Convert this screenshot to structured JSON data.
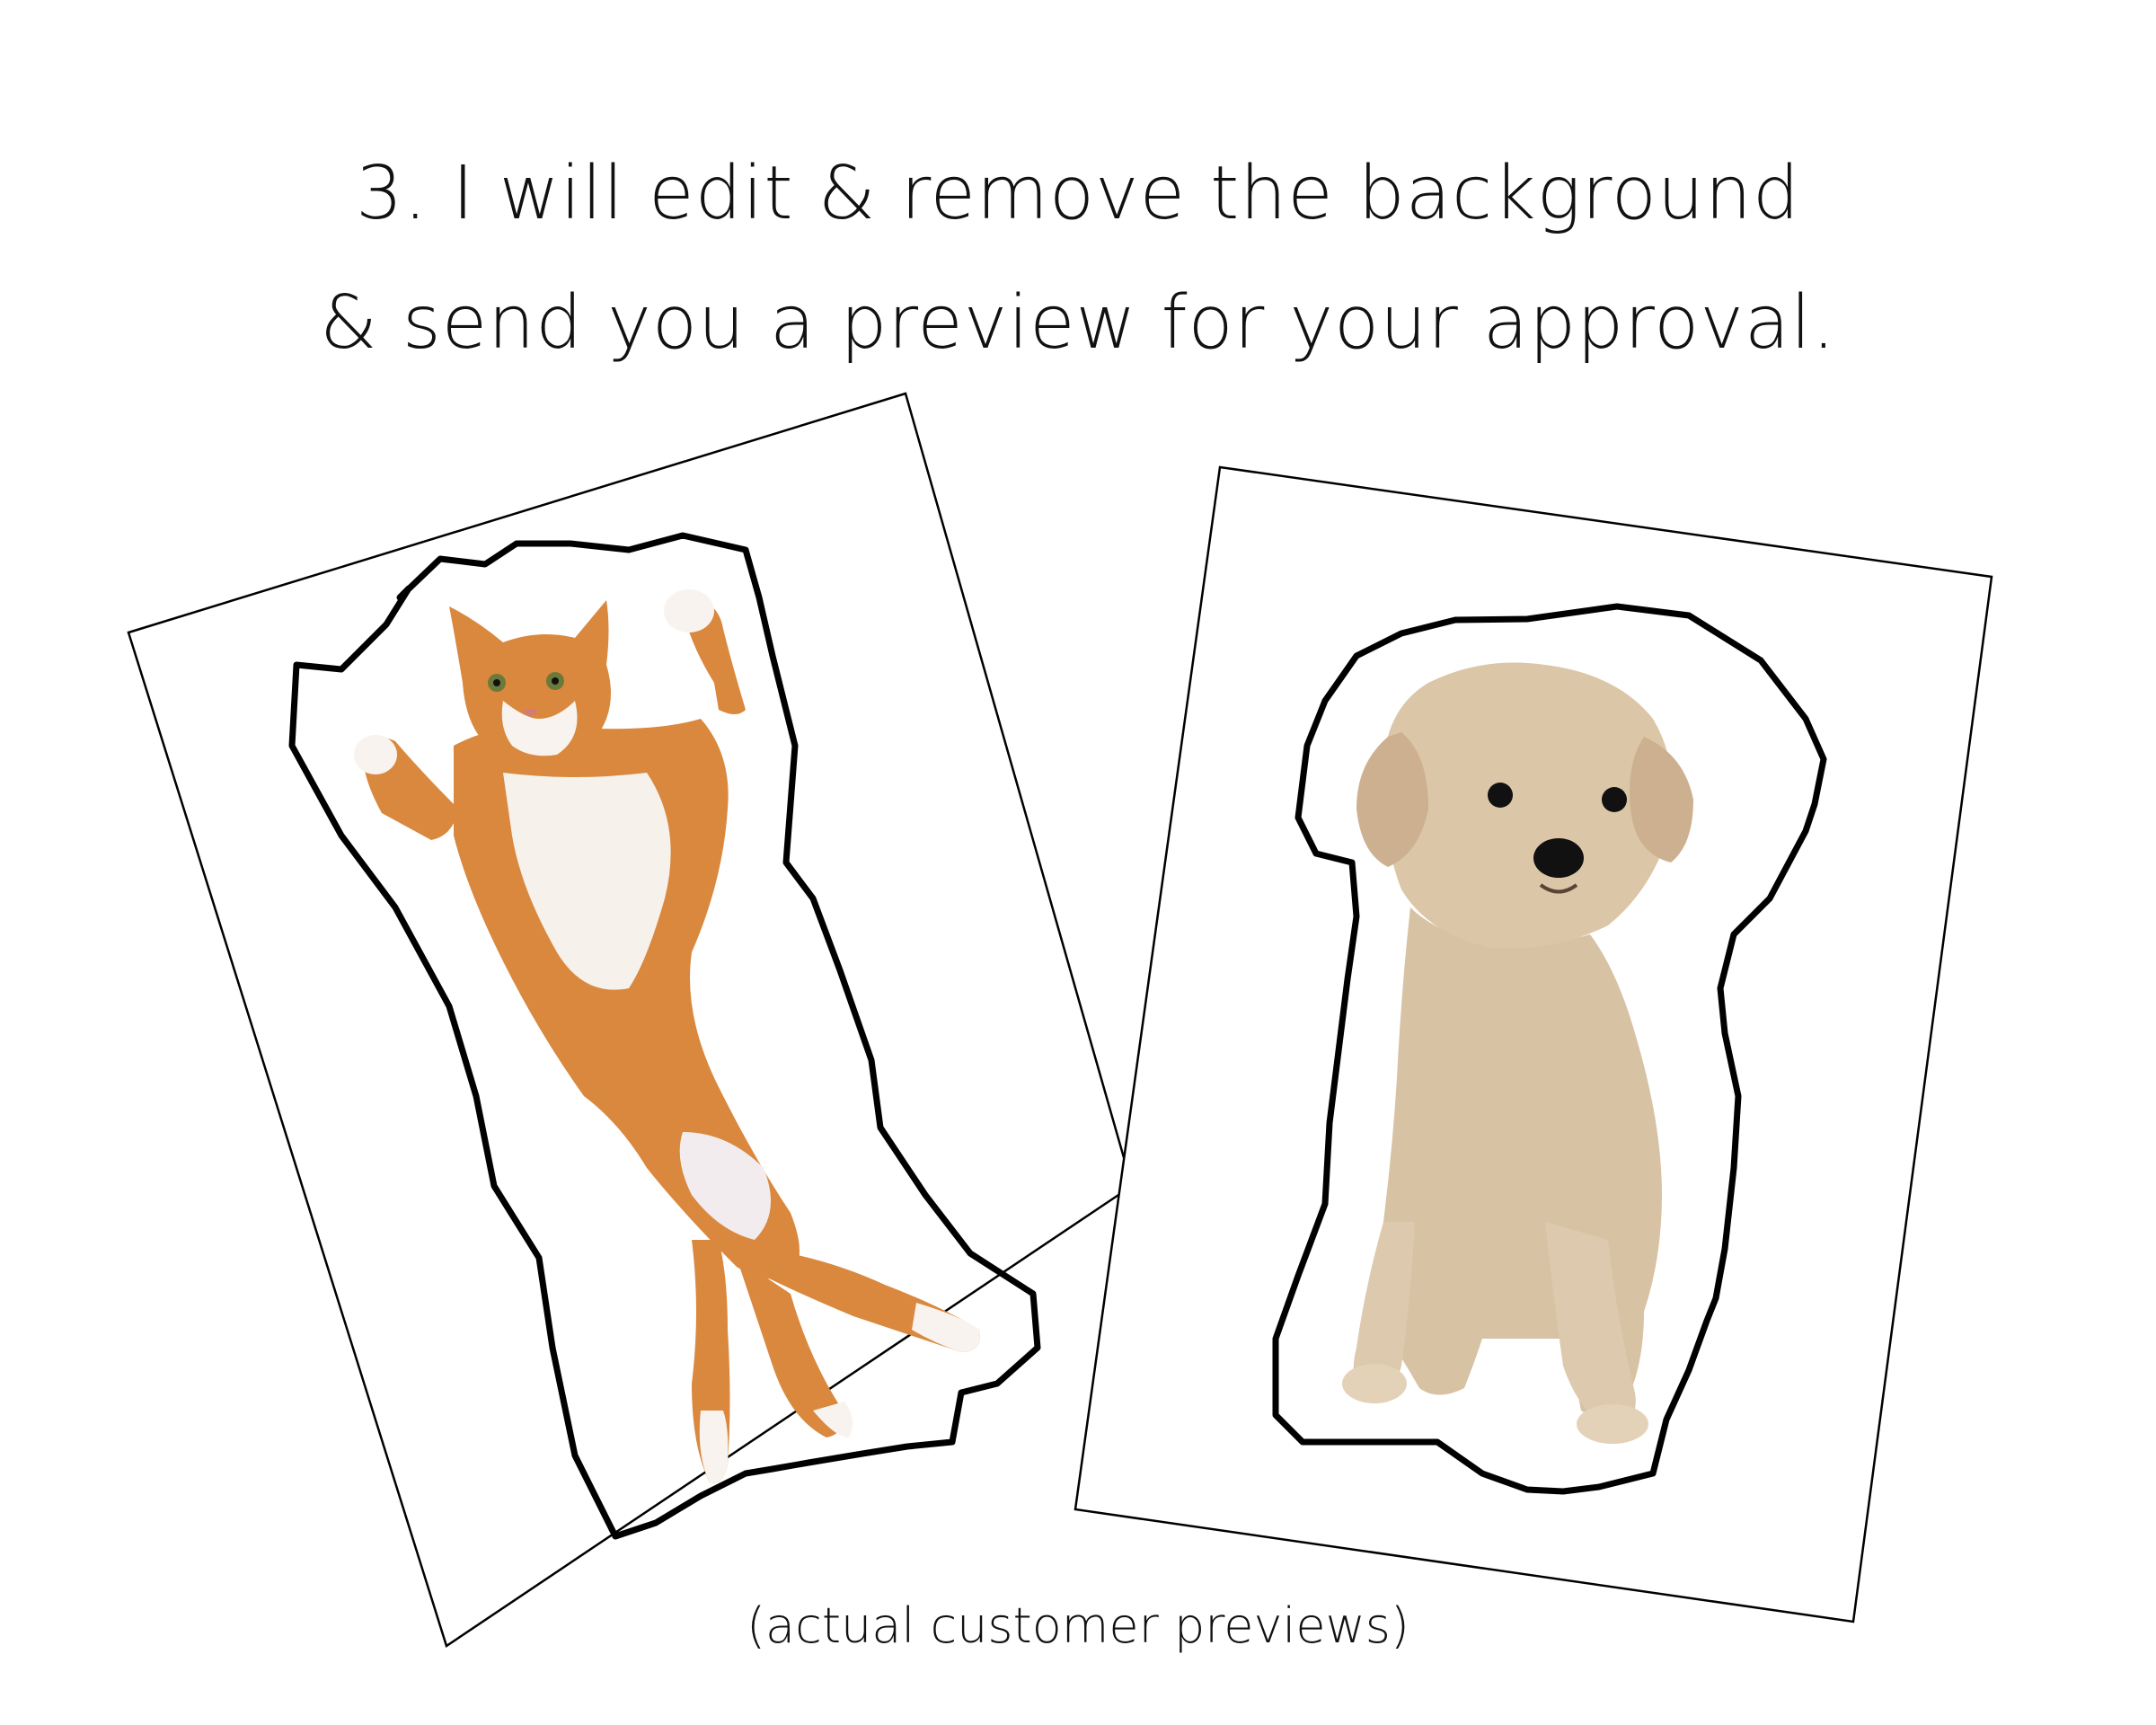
{
  "headline": {
    "line1": "3.  I will edit & remove the background",
    "line2": "& send you a preview for your approval."
  },
  "caption": "(actual customer previews)",
  "previews": [
    {
      "subject": "orange-white-cat",
      "colors": {
        "fur": "#d9883e",
        "belly": "#f6f1ea",
        "outline": "#000000"
      }
    },
    {
      "subject": "cream-puppy",
      "colors": {
        "fur": "#d8c2a4",
        "outline": "#000000"
      }
    }
  ]
}
